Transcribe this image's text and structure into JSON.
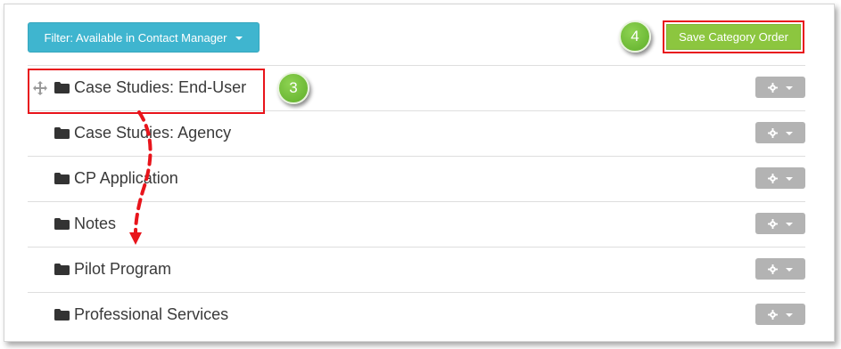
{
  "toolbar": {
    "filter_label": "Filter: Available in Contact Manager",
    "save_label": "Save Category Order"
  },
  "callouts": {
    "step_save": "4",
    "step_drag": "3"
  },
  "categories": [
    {
      "label": "Case Studies: End-User",
      "icon": "folder-icon"
    },
    {
      "label": "Case Studies: Agency",
      "icon": "folder-icon"
    },
    {
      "label": "CP Application",
      "icon": "folder-icon"
    },
    {
      "label": "Notes",
      "icon": "folder-icon"
    },
    {
      "label": "Pilot Program",
      "icon": "folder-icon"
    },
    {
      "label": "Professional Services",
      "icon": "folder-icon"
    }
  ],
  "colors": {
    "filter_button": "#3fb5cf",
    "save_button": "#8cc63f",
    "annotation_red": "#e8141b",
    "callout_green": "#6cbf33",
    "gear_button": "#b3b3b3"
  }
}
